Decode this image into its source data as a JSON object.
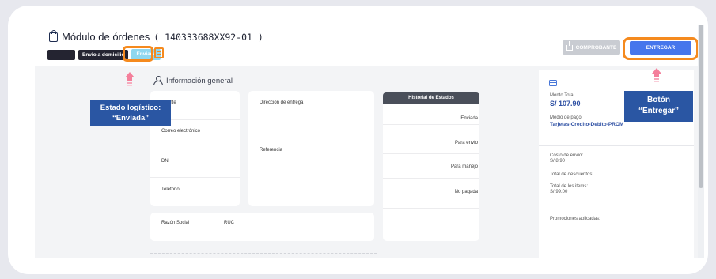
{
  "header": {
    "title": "Módulo de órdenes",
    "order_id": "( 140333688XX92-01 )",
    "badge_delivery": "Envio a domicilio",
    "badge_status": "Enviada",
    "btn_comprobante": "COMPROBANTE",
    "btn_entregar": "ENTREGAR"
  },
  "section": {
    "title": "Información general"
  },
  "client_card": {
    "cliente": "Cliente",
    "email": "Correo electrónico",
    "dni": "DNI",
    "telefono": "Teléfono"
  },
  "address_card": {
    "direccion": "Dirección de entrega",
    "referencia": "Referencia"
  },
  "company_card": {
    "razon_social": "Razón Social",
    "ruc": "RUC"
  },
  "history": {
    "title": "Historial de Estados",
    "items": [
      "Enviada",
      "Para envío",
      "Para manejo",
      "No pagada"
    ]
  },
  "summary": {
    "total_label": "Monto Total",
    "total_value": "S/ 107.90",
    "payment_label": "Medio de pago:",
    "payment_value": "Tarjetas-Credito-Debito-PROM",
    "shipping_label": "Costo de envío:",
    "shipping_value": "S/ 8.90",
    "discounts_label": "Total de descuentos:",
    "items_label": "Total de los items:",
    "items_value": "S/ 99.00",
    "promos_label": "Promociones aplicadas:"
  },
  "callouts": {
    "left_line1": "Estado logístico:",
    "left_line2": "“Enviada”",
    "right_line1": "Botón",
    "right_line2": "“Entregar”"
  },
  "colors": {
    "accent_blue": "#4676ec",
    "highlight_orange": "#f58a1e",
    "callout_blue": "#2a56a3",
    "status_badge": "#8fd7ef"
  }
}
